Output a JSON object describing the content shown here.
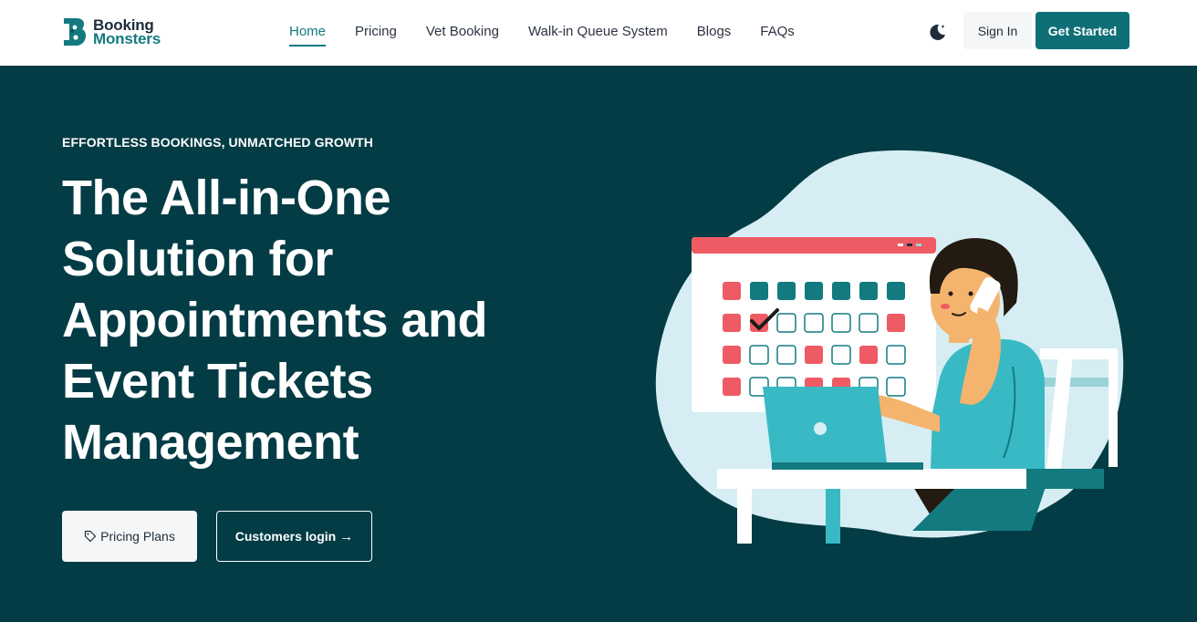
{
  "brand": {
    "line1": "Booking",
    "line2": "Monsters",
    "logo_icon": "booking-monsters-logo"
  },
  "nav": {
    "items": [
      {
        "label": "Home",
        "active": true
      },
      {
        "label": "Pricing",
        "active": false
      },
      {
        "label": "Vet Booking",
        "active": false
      },
      {
        "label": "Walk-in Queue System",
        "active": false
      },
      {
        "label": "Blogs",
        "active": false
      },
      {
        "label": "FAQs",
        "active": false
      }
    ]
  },
  "header_actions": {
    "theme_icon": "moon-icon",
    "signin_label": "Sign In",
    "start_label": "Get Started"
  },
  "hero": {
    "eyebrow": "EFFORTLESS BOOKINGS, UNMATCHED GROWTH",
    "headline_lines": [
      "The All-in-One",
      "Solution for",
      "Appointments and",
      "Event Tickets",
      "Management"
    ],
    "pricing_button": {
      "label": "Pricing Plans",
      "icon": "tag-icon"
    },
    "login_button": {
      "label": "Customers login",
      "icon": "arrow-right-icon",
      "glyph": "→"
    }
  },
  "colors": {
    "brand_teal": "#137a80",
    "hero_bg": "#033c45",
    "cta_bg": "#0e6f77",
    "calendar_red": "#ef5b64",
    "calendar_teal": "#137a80",
    "blob": "#d6eef3"
  }
}
